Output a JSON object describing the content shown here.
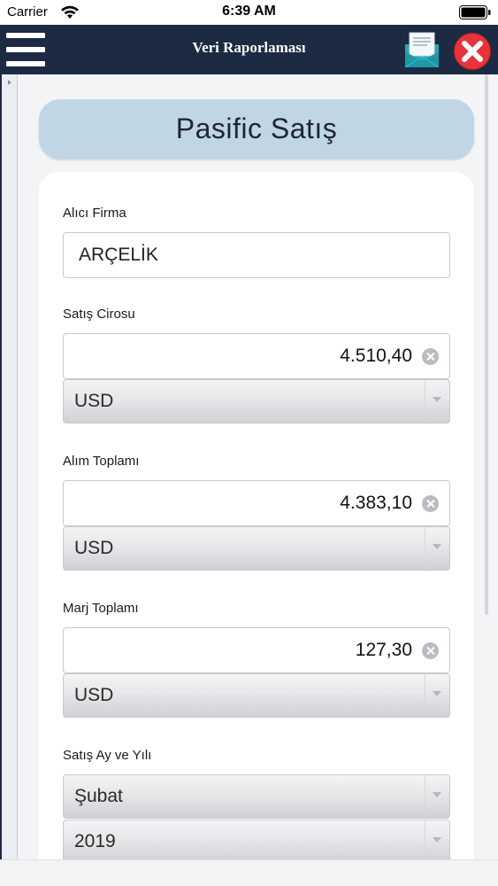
{
  "status_bar": {
    "carrier": "Carrier",
    "time": "6:39 AM"
  },
  "header": {
    "title": "Veri Raporlaması",
    "icons": {
      "menu": "hamburger-menu-icon",
      "mail": "mail-icon",
      "close": "close-icon"
    },
    "colors": {
      "bar": "#1d2a44",
      "close": "#e8333a",
      "mail": "#2aa7b4"
    }
  },
  "page": {
    "title": "Pasific Satış"
  },
  "form": {
    "buyer": {
      "label": "Alıcı Firma",
      "value": "ARÇELİK"
    },
    "sales_revenue": {
      "label": "Satış Cirosu",
      "value": "4.510,40",
      "currency": "USD"
    },
    "purchase_total": {
      "label": "Alım Toplamı",
      "value": "4.383,10",
      "currency": "USD"
    },
    "margin_total": {
      "label": "Marj Toplamı",
      "value": "127,30",
      "currency": "USD"
    },
    "sale_period": {
      "label": "Satış Ay ve Yılı",
      "month": "Şubat",
      "year": "2019"
    }
  }
}
